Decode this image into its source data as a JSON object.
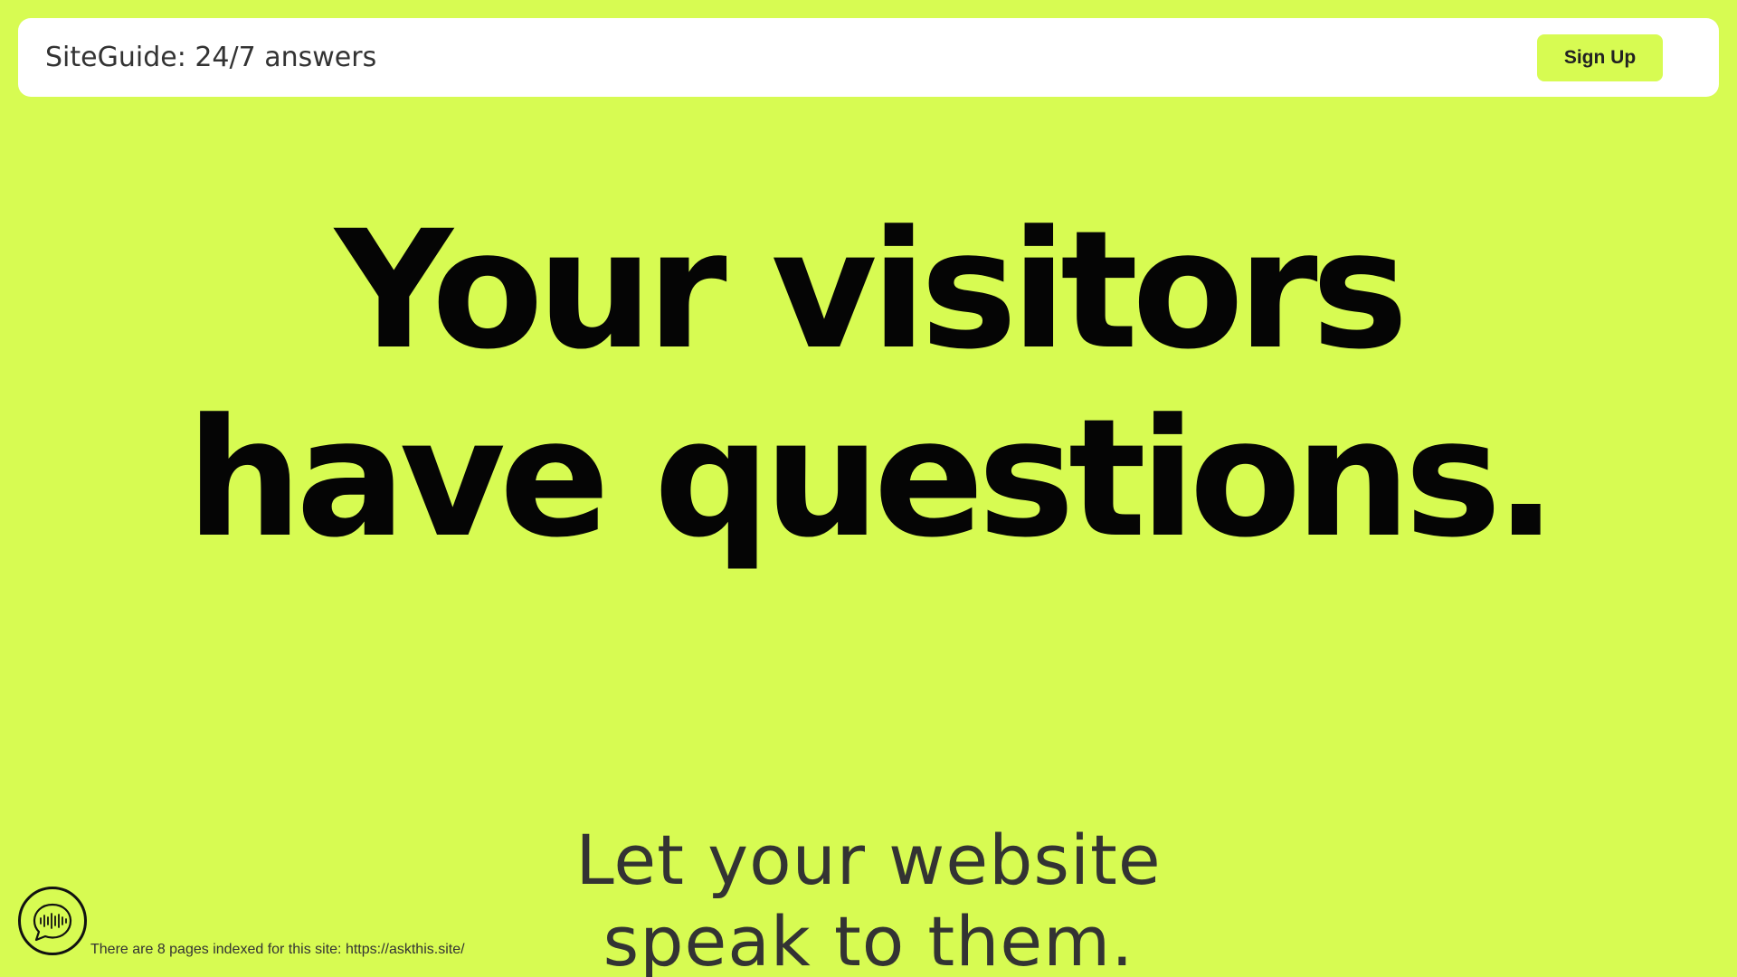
{
  "header": {
    "brand": "SiteGuide: 24/7 answers",
    "signup_label": "Sign Up"
  },
  "hero": {
    "line1": "Your visitors",
    "line2": "have questions."
  },
  "subhead": {
    "line1": "Let your website",
    "line2": "speak to them."
  },
  "footer": {
    "indexed_text": "There are 8 pages indexed for this site: https://askthis.site/"
  },
  "icons": {
    "chat_widget": "chat-bubble-soundwave-icon"
  },
  "colors": {
    "background": "#d7fb52",
    "accent": "#d7fb52",
    "header_bg": "#ffffff",
    "text": "#050505"
  }
}
